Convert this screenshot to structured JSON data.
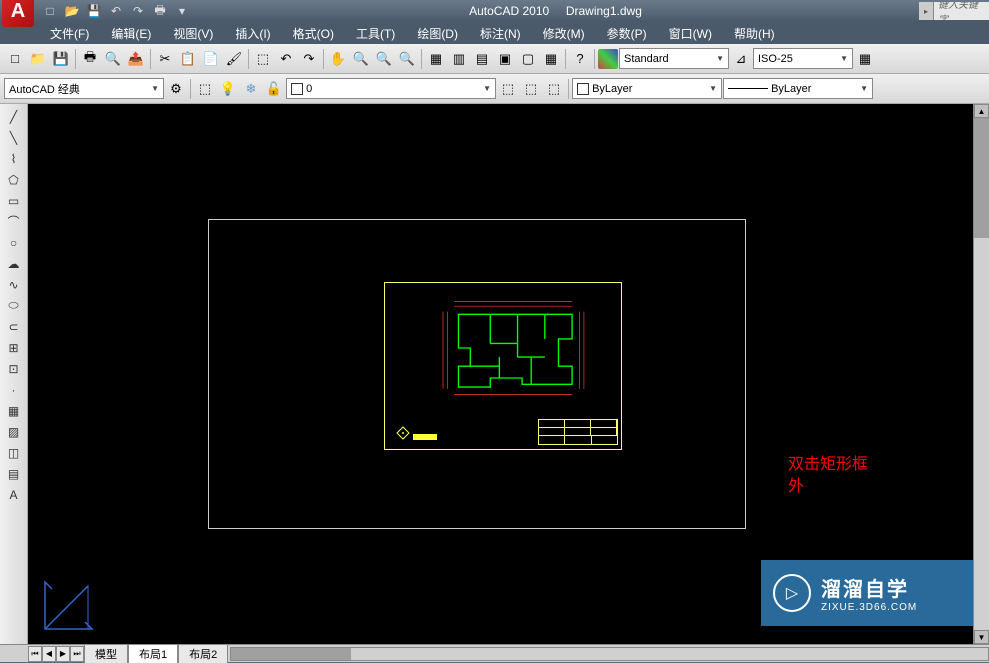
{
  "title": {
    "app": "AutoCAD 2010",
    "file": "Drawing1.dwg",
    "search_placeholder": "键入关键字"
  },
  "qat": [
    "new",
    "open",
    "save",
    "undo",
    "redo",
    "print"
  ],
  "menu": {
    "file": "文件(F)",
    "edit": "编辑(E)",
    "view": "视图(V)",
    "insert": "插入(I)",
    "format": "格式(O)",
    "tools": "工具(T)",
    "draw": "绘图(D)",
    "dimension": "标注(N)",
    "modify": "修改(M)",
    "param": "参数(P)",
    "window": "窗口(W)",
    "help": "帮助(H)"
  },
  "toolbar1": {
    "workspace": "AutoCAD 经典",
    "layer_value": "0",
    "text_style": "Standard",
    "dim_style": "ISO-25"
  },
  "properties": {
    "color": "ByLayer",
    "linetype": "ByLayer"
  },
  "tabs": {
    "model": "模型",
    "layout1": "布局1",
    "layout2": "布局2"
  },
  "annotation": {
    "line1": "双击矩形框",
    "line2": "外"
  },
  "watermark": {
    "main": "溜溜自学",
    "sub": "ZIXUE.3D66.COM"
  }
}
